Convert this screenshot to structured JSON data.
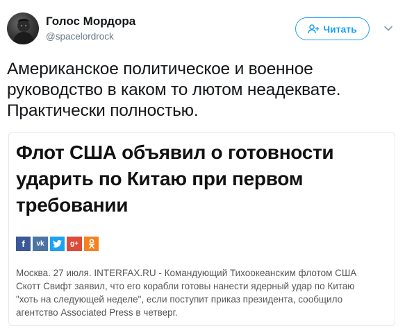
{
  "user": {
    "name": "Голос Мордора",
    "handle": "@spacelordrock"
  },
  "follow_button": {
    "label": "Читать"
  },
  "tweet": {
    "text_lines": [
      "Американское политическое и военное",
      "руководство в каком то лютом неадеквате.",
      "Практически полностью."
    ]
  },
  "card": {
    "headline_lines": [
      "Флот США объявил о готовности",
      "ударить по Китаю при первом",
      "требовании"
    ],
    "share_buttons": [
      {
        "icon": "facebook-icon",
        "glyph": "f",
        "color": "#3b5998"
      },
      {
        "icon": "vk-icon",
        "glyph": "vk",
        "color": "#4c75a3"
      },
      {
        "icon": "twitter-icon",
        "glyph": "t",
        "color": "#1da1f2"
      },
      {
        "icon": "google-plus-icon",
        "glyph": "g+",
        "color": "#dd4b39"
      },
      {
        "icon": "odnoklassniki-icon",
        "glyph": "ok",
        "color": "#f58220"
      }
    ],
    "body_lines": [
      "Москва. 27 июля. INTERFAX.RU - Командующий Тихоокеанским флотом США",
      "Скотт Свифт заявил, что его корабли готовы нанести ядерный удар по Китаю",
      "\"хоть на следующей неделе\", если поступит приказ президента, сообщило",
      "агентство Associated Press в четверг."
    ]
  },
  "colors": {
    "accent": "#1da1f2",
    "text": "#14171a",
    "secondary": "#657786",
    "card_border": "#e1e8ed"
  }
}
